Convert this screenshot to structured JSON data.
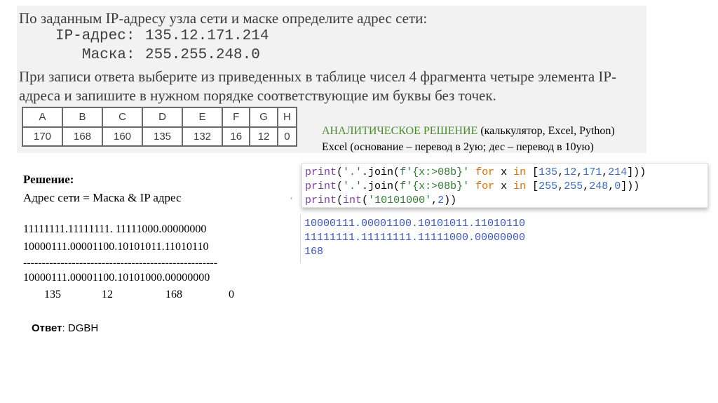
{
  "task": {
    "line1": "По заданным IP-адресу узла сети и маске определите адрес сети:",
    "ip_label": "IP-адрес:",
    "ip_value": "135.12.171.214",
    "mask_label": "Маска:",
    "mask_value": "255.255.248.0",
    "instr_line1": "При записи ответа выберите из приведенных в таблице чисел 4 фрагмента четыре элемента IP-",
    "instr_line2": "адреса и запишите в нужном порядке соответствующие им буквы без точек.",
    "table": {
      "letters": [
        "A",
        "B",
        "C",
        "D",
        "E",
        "F",
        "G",
        "H"
      ],
      "values": [
        "170",
        "168",
        "160",
        "135",
        "132",
        "16",
        "12",
        "0"
      ]
    }
  },
  "analytic": {
    "title": "АНАЛИТИЧЕСКОЕ РЕШЕНИЕ",
    "tools": " (калькулятор, Excel, Python)",
    "excel_note": "Excel (основание – перевод в 2ую; дес – перевод в 10ую)"
  },
  "code": {
    "lines": [
      "print('.'.join(f'{x:>08b}' for x in [135,12,171,214]))",
      "print('.'.join(f'{x:>08b}' for x in [255,255,248,0]))",
      "print(int('10101000',2))"
    ],
    "output": [
      "10000111.00001100.10101011.11010110",
      "11111111.11111111.11111000.00000000",
      "168"
    ]
  },
  "solution": {
    "heading": "Решение:",
    "formula": "Адрес сети = Маска & IP адрес",
    "mask_bin": "11111111.11111111. 11111000.00000000",
    "ip_bin": "10000111.00001100.10101011.11010110",
    "divider": "----------------------------------------------------",
    "result_bin": "10000111.00001100.10101000.00000000",
    "decimal": [
      "135",
      "12",
      "168",
      "0"
    ],
    "answer_label": "Ответ",
    "answer_value": ": DGBH"
  }
}
